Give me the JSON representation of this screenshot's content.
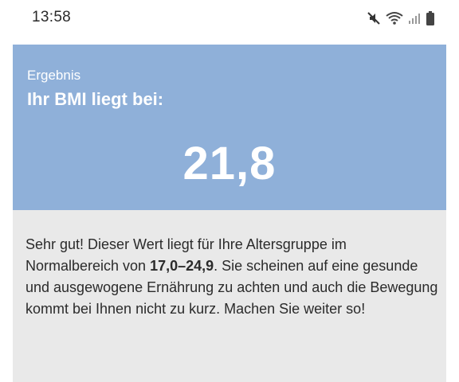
{
  "status_bar": {
    "time": "13:58",
    "icons": [
      "mute-icon",
      "wifi-icon",
      "signal-icon",
      "battery-icon"
    ]
  },
  "result": {
    "label": "Ergebnis",
    "title": "Ihr BMI liegt bei:",
    "bmi_value": "21,8",
    "text_part1": "Sehr gut! Dieser Wert liegt für Ihre Altersgruppe im Normalbereich von ",
    "normal_range": "17,0–24,9",
    "text_part2": ". Sie scheinen auf eine gesunde und ausgewogene Ernährung zu achten und auch die Bewegung kommt bei Ihnen nicht zu kurz. Machen Sie weiter so!"
  },
  "colors": {
    "header_background": "#8fb0d9",
    "card_background": "#e9e9e9",
    "text": "#2b2b2b"
  }
}
